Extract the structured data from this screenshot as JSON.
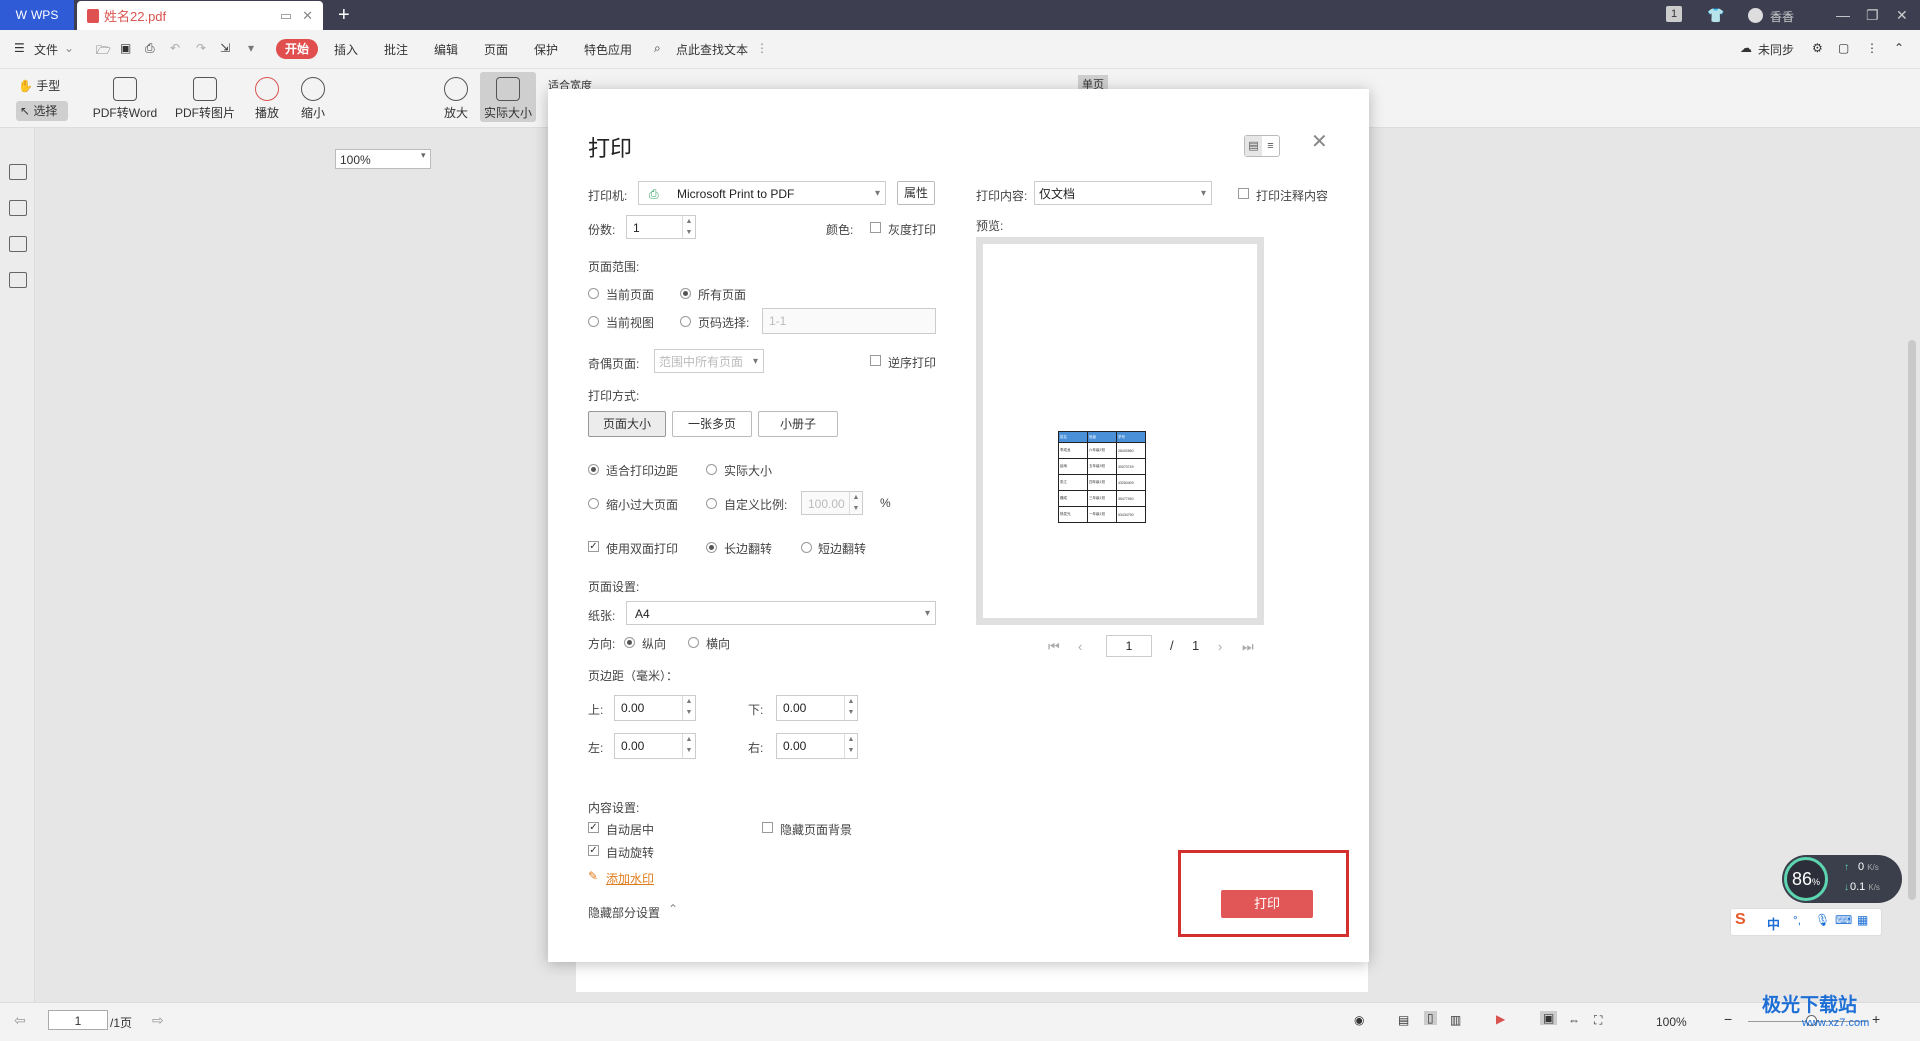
{
  "titlebar": {
    "app_label": "WPS",
    "tab_name": "姓名22.pdf",
    "page_badge": "1",
    "user": "香香"
  },
  "menubar": {
    "file": "文件",
    "start": "开始",
    "items": [
      "插入",
      "批注",
      "编辑",
      "页面",
      "保护",
      "特色应用"
    ],
    "search": "点此查找文本",
    "sync": "未同步"
  },
  "toolbar": {
    "hand": "手型",
    "select": "选择",
    "pdf_to_word": "PDF转Word",
    "pdf_to_image": "PDF转图片",
    "play": "播放",
    "zoom_out": "缩小",
    "zoom_value": "100%",
    "zoom_in": "放大",
    "actual_size": "实际大小",
    "fit_width": "适合宽度",
    "single_page": "单页"
  },
  "dialog": {
    "title": "打印",
    "printer_label": "打印机:",
    "printer_value": "Microsoft Print to PDF",
    "properties": "属性",
    "copies_label": "份数:",
    "copies_value": "1",
    "color_label": "颜色:",
    "grayscale": "灰度打印",
    "range_label": "页面范围:",
    "current_page": "当前页面",
    "all_pages": "所有页面",
    "current_view": "当前视图",
    "page_select": "页码选择:",
    "page_select_placeholder": "1-1",
    "odd_even_label": "奇偶页面:",
    "odd_even_value": "范围中所有页面",
    "reverse_print": "逆序打印",
    "mode_label": "打印方式:",
    "mode_page_size": "页面大小",
    "mode_multi": "一张多页",
    "mode_booklet": "小册子",
    "fit_margin": "适合打印边距",
    "actual_size": "实际大小",
    "shrink_large": "缩小过大页面",
    "custom_scale": "自定义比例:",
    "custom_scale_value": "100.00",
    "percent": "%",
    "duplex": "使用双面打印",
    "long_edge": "长边翻转",
    "short_edge": "短边翻转",
    "page_setup_label": "页面设置:",
    "paper_label": "纸张:",
    "paper_value": "A4",
    "orient_label": "方向:",
    "portrait": "纵向",
    "landscape": "横向",
    "margin_label": "页边距（毫米）：",
    "top_label": "上:",
    "top_value": "0.00",
    "bottom_label": "下:",
    "bottom_value": "0.00",
    "left_label": "左:",
    "left_value": "0.00",
    "right_label": "右:",
    "right_value": "0.00",
    "content_label": "内容设置:",
    "auto_center": "自动居中",
    "hide_bg": "隐藏页面背景",
    "auto_rotate": "自动旋转",
    "add_watermark": "添加水印",
    "hide_settings": "隐藏部分设置",
    "print_content_label": "打印内容:",
    "print_content_value": "仅文档",
    "print_annotations": "打印注释内容",
    "preview_label": "预览:",
    "preview_page": "1",
    "preview_sep": "/",
    "preview_total": "1",
    "print_button": "打印"
  },
  "preview_table": {
    "headers": [
      "姓名",
      "班级",
      "学号"
    ],
    "rows": [
      [
        "李成龙",
        "六年级2班",
        "28400560"
      ],
      [
        "赵雨",
        "五年级3班",
        "30070749"
      ],
      [
        "张江",
        "四年级1班",
        "43260409"
      ],
      [
        "魏成",
        "三年级1班",
        "35477940"
      ],
      [
        "杨发光",
        "一年级1班",
        "53434790"
      ]
    ]
  },
  "statusbar": {
    "page_value": "1",
    "page_total": "/1页",
    "zoom": "100%"
  },
  "widgets": {
    "speed_percent": "86",
    "speed_unit": "%",
    "up": "0",
    "up_unit": "K/s",
    "down": "0.1",
    "down_unit": "K/s",
    "ime_lang": "中",
    "watermark": "极光下载站",
    "watermark_url": "www.xz7.com"
  }
}
